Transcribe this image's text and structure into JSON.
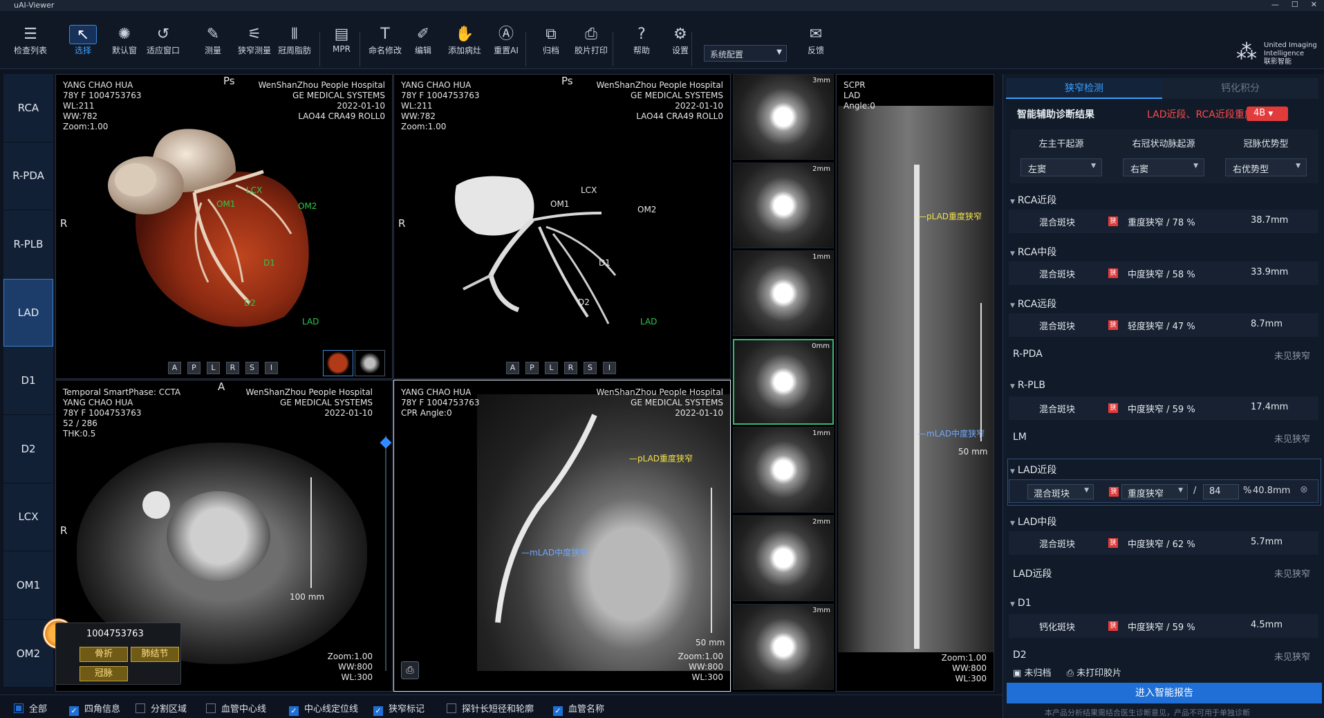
{
  "app_title": "uAI-Viewer",
  "toolbar": {
    "tools": [
      {
        "label": "检查列表",
        "icon": "list-icon"
      },
      {
        "label": "选择",
        "icon": "pointer-icon",
        "active": true
      },
      {
        "label": "默认窗",
        "icon": "window-level-icon"
      },
      {
        "label": "适应窗口",
        "icon": "fit-window-icon"
      },
      {
        "label": "测量",
        "icon": "ruler-icon"
      },
      {
        "label": "狭窄测量",
        "icon": "stenosis-measure-icon"
      },
      {
        "label": "冠周脂肪",
        "icon": "pericoronary-fat-icon"
      },
      {
        "label": "MPR",
        "icon": "mpr-icon"
      },
      {
        "label": "命名修改",
        "icon": "rename-icon"
      },
      {
        "label": "编辑",
        "icon": "edit-icon"
      },
      {
        "label": "添加病灶",
        "icon": "add-lesion-icon"
      },
      {
        "label": "重置AI",
        "icon": "reset-ai-icon"
      },
      {
        "label": "归档",
        "icon": "archive-icon"
      },
      {
        "label": "胶片打印",
        "icon": "film-print-icon"
      },
      {
        "label": "帮助",
        "icon": "help-icon"
      },
      {
        "label": "设置",
        "icon": "settings-icon"
      },
      {
        "label": "反馈",
        "icon": "feedback-icon"
      }
    ],
    "system_config": "系统配置",
    "logo_text": "United Imaging\nIntelligence\n联影智能"
  },
  "vessels": [
    "RCA",
    "R-PDA",
    "R-PLB",
    "LAD",
    "D1",
    "D2",
    "LCX",
    "OM1",
    "OM2"
  ],
  "selected_vessel": "LAD",
  "viewports": {
    "vr": {
      "info_left": "YANG CHAO HUA\n78Y F 1004753763\nWL:211\nWW:782\nZoom:1.00",
      "info_right": "WenShanZhou People Hospital\nGE MEDICAL SYSTEMS\n2022-01-10\nLAO44 CRA49 ROLL0",
      "orient_top": "Ps",
      "orient_left": "R",
      "labels": [
        "LCX",
        "OM1",
        "OM2",
        "D1",
        "D2",
        "LAD"
      ],
      "buttons": [
        "A",
        "P",
        "L",
        "R",
        "S",
        "I"
      ]
    },
    "mip": {
      "info_left": "YANG CHAO HUA\n78Y F 1004753763\nWL:211\nWW:782\nZoom:1.00",
      "info_right": "WenShanZhou People Hospital\nGE MEDICAL SYSTEMS\n2022-01-10\nLAO44 CRA49 ROLL0",
      "orient_top": "Ps",
      "orient_left": "R",
      "labels": [
        "LCX",
        "OM1",
        "OM2",
        "D1",
        "D2",
        "LAD"
      ],
      "buttons": [
        "A",
        "P",
        "L",
        "R",
        "S",
        "I"
      ]
    },
    "axial": {
      "info_left": "Temporal SmartPhase: CCTA\nYANG CHAO HUA\n78Y F 1004753763\n52 / 286\nTHK:0.5",
      "info_right": "WenShanZhou People Hospital\nGE MEDICAL SYSTEMS\n2022-01-10",
      "orient_top": "A",
      "orient_left": "R",
      "scale": "100 mm",
      "wl": "Zoom:1.00\nWW:800\nWL:300"
    },
    "cpr": {
      "info_left": "YANG CHAO HUA\n78Y F 1004753763\nCPR Angle:0",
      "info_right": "WenShanZhou People Hospital\nGE MEDICAL SYSTEMS\n2022-01-10",
      "annot1": "pLAD重度狭窄",
      "annot2": "mLAD中度狭窄",
      "scale": "50 mm",
      "wl": "Zoom:1.00\nWW:800\nWL:300"
    },
    "strip": [
      "3mm",
      "2mm",
      "1mm",
      "0mm",
      "1mm",
      "2mm",
      "3mm"
    ],
    "scpr": {
      "info": "SCPR\nLAD\nAngle:0",
      "annot1": "pLAD重度狭窄",
      "annot2": "mLAD中度狭窄",
      "scale": "50 mm",
      "wl": "Zoom:1.00\nWW:800\nWL:300"
    }
  },
  "popup": {
    "id": "1004753763",
    "buttons": [
      "骨折",
      "肺结节",
      "冠脉"
    ]
  },
  "bottom_options": [
    {
      "label": "全部",
      "state": "partial"
    },
    {
      "label": "四角信息",
      "state": "on"
    },
    {
      "label": "分割区域",
      "state": "off"
    },
    {
      "label": "血管中心线",
      "state": "off"
    },
    {
      "label": "中心线定位线",
      "state": "on"
    },
    {
      "label": "狭窄标记",
      "state": "on"
    },
    {
      "label": "探针长短径和轮廓",
      "state": "off"
    },
    {
      "label": "血管名称",
      "state": "on"
    }
  ],
  "side": {
    "tab_active": "狭窄检测",
    "tab_other": "钙化积分",
    "diag_title": "智能辅助诊断结果",
    "diag_result": "LAD近段、RCA近段重度...",
    "badge": "4B",
    "headers": [
      "左主干起源",
      "右冠状动脉起源",
      "冠脉优势型"
    ],
    "header_values": [
      "左窦",
      "右窦",
      "右优势型"
    ],
    "segments": [
      {
        "name": "RCA近段",
        "expanded": true,
        "plaque": "混合斑块",
        "sten": "重度狭窄 / 78 %",
        "len": "38.7mm"
      },
      {
        "name": "RCA中段",
        "expanded": true,
        "plaque": "混合斑块",
        "sten": "中度狭窄 / 58 %",
        "len": "33.9mm"
      },
      {
        "name": "RCA远段",
        "expanded": true,
        "plaque": "混合斑块",
        "sten": "轻度狭窄 / 47 %",
        "len": "8.7mm"
      },
      {
        "name": "R-PDA",
        "expanded": false,
        "none": "未见狭窄"
      },
      {
        "name": "R-PLB",
        "expanded": true,
        "plaque": "混合斑块",
        "sten": "中度狭窄 / 59 %",
        "len": "17.4mm"
      },
      {
        "name": "LM",
        "expanded": false,
        "none": "未见狭窄"
      },
      {
        "name": "LAD近段",
        "expanded": true,
        "editing": true,
        "plaque": "混合斑块",
        "sten_kind": "重度狭窄",
        "sten_pct": "84",
        "len": "40.8mm"
      },
      {
        "name": "LAD中段",
        "expanded": true,
        "plaque": "混合斑块",
        "sten": "中度狭窄 / 62 %",
        "len": "5.7mm"
      },
      {
        "name": "LAD远段",
        "expanded": false,
        "none": "未见狭窄"
      },
      {
        "name": "D1",
        "expanded": true,
        "plaque": "钙化斑块",
        "sten": "中度狭窄 / 59 %",
        "len": "4.5mm"
      },
      {
        "name": "D2",
        "expanded": false,
        "none": "未见狭窄"
      }
    ],
    "archive_status": "未归档",
    "print_status": "未打印胶片",
    "report_button": "进入智能报告",
    "disclaimer": "本产品分析结果需结合医生诊断意见，产品不可用于单独诊断",
    "accent": "#1f6fd6",
    "danger": "#e23b3b"
  }
}
